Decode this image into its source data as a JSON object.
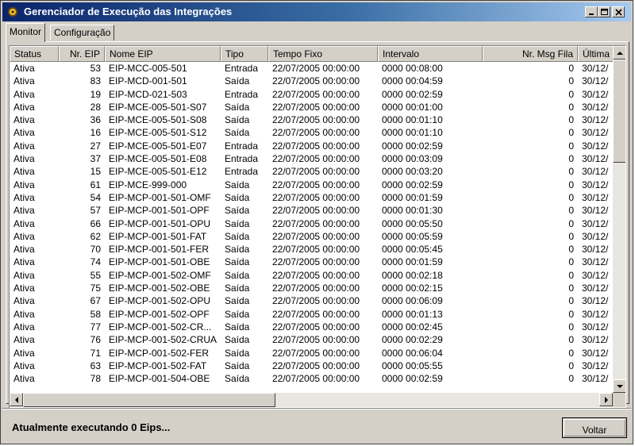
{
  "window": {
    "title": "Gerenciador de Execução das Integrações"
  },
  "tabs": [
    {
      "label": "Monitor"
    },
    {
      "label": "Configuração"
    }
  ],
  "columns": [
    "Status",
    "Nr. EIP",
    "Nome EIP",
    "Tipo",
    "Tempo Fixo",
    "Intervalo",
    "Nr. Msg Fila",
    "Última I"
  ],
  "rows": [
    [
      "Ativa",
      "53",
      "EIP-MCC-005-501",
      "Entrada",
      "22/07/2005 00:00:00",
      "0000 00:08:00",
      "0",
      "30/12/"
    ],
    [
      "Ativa",
      "83",
      "EIP-MCD-001-501",
      "Saída",
      "22/07/2005 00:00:00",
      "0000 00:04:59",
      "0",
      "30/12/"
    ],
    [
      "Ativa",
      "19",
      "EIP-MCD-021-503",
      "Entrada",
      "22/07/2005 00:00:00",
      "0000 00:02:59",
      "0",
      "30/12/"
    ],
    [
      "Ativa",
      "28",
      "EIP-MCE-005-501-S07",
      "Saída",
      "22/07/2005 00:00:00",
      "0000 00:01:00",
      "0",
      "30/12/"
    ],
    [
      "Ativa",
      "36",
      "EIP-MCE-005-501-S08",
      "Saída",
      "22/07/2005 00:00:00",
      "0000 00:01:10",
      "0",
      "30/12/"
    ],
    [
      "Ativa",
      "16",
      "EIP-MCE-005-501-S12",
      "Saída",
      "22/07/2005 00:00:00",
      "0000 00:01:10",
      "0",
      "30/12/"
    ],
    [
      "Ativa",
      "27",
      "EIP-MCE-005-501-E07",
      "Entrada",
      "22/07/2005 00:00:00",
      "0000 00:02:59",
      "0",
      "30/12/"
    ],
    [
      "Ativa",
      "37",
      "EIP-MCE-005-501-E08",
      "Entrada",
      "22/07/2005 00:00:00",
      "0000 00:03:09",
      "0",
      "30/12/"
    ],
    [
      "Ativa",
      "15",
      "EIP-MCE-005-501-E12",
      "Entrada",
      "22/07/2005 00:00:00",
      "0000 00:03:20",
      "0",
      "30/12/"
    ],
    [
      "Ativa",
      "61",
      "EIP-MCE-999-000",
      "Saída",
      "22/07/2005 00:00:00",
      "0000 00:02:59",
      "0",
      "30/12/"
    ],
    [
      "Ativa",
      "54",
      "EIP-MCP-001-501-OMF",
      "Saída",
      "22/07/2005 00:00:00",
      "0000 00:01:59",
      "0",
      "30/12/"
    ],
    [
      "Ativa",
      "57",
      "EIP-MCP-001-501-OPF",
      "Saída",
      "22/07/2005 00:00:00",
      "0000 00:01:30",
      "0",
      "30/12/"
    ],
    [
      "Ativa",
      "66",
      "EIP-MCP-001-501-OPU",
      "Saída",
      "22/07/2005 00:00:00",
      "0000 00:05:50",
      "0",
      "30/12/"
    ],
    [
      "Ativa",
      "62",
      "EIP-MCP-001-501-FAT",
      "Saída",
      "22/07/2005 00:00:00",
      "0000 00:05:59",
      "0",
      "30/12/"
    ],
    [
      "Ativa",
      "70",
      "EIP-MCP-001-501-FER",
      "Saída",
      "22/07/2005 00:00:00",
      "0000 00:05:45",
      "0",
      "30/12/"
    ],
    [
      "Ativa",
      "74",
      "EIP-MCP-001-501-OBE",
      "Saída",
      "22/07/2005 00:00:00",
      "0000 00:01:59",
      "0",
      "30/12/"
    ],
    [
      "Ativa",
      "55",
      "EIP-MCP-001-502-OMF",
      "Saída",
      "22/07/2005 00:00:00",
      "0000 00:02:18",
      "0",
      "30/12/"
    ],
    [
      "Ativa",
      "75",
      "EIP-MCP-001-502-OBE",
      "Saída",
      "22/07/2005 00:00:00",
      "0000 00:02:15",
      "0",
      "30/12/"
    ],
    [
      "Ativa",
      "67",
      "EIP-MCP-001-502-OPU",
      "Saída",
      "22/07/2005 00:00:00",
      "0000 00:06:09",
      "0",
      "30/12/"
    ],
    [
      "Ativa",
      "58",
      "EIP-MCP-001-502-OPF",
      "Saída",
      "22/07/2005 00:00:00",
      "0000 00:01:13",
      "0",
      "30/12/"
    ],
    [
      "Ativa",
      "77",
      "EIP-MCP-001-502-CR...",
      "Saída",
      "22/07/2005 00:00:00",
      "0000 00:02:45",
      "0",
      "30/12/"
    ],
    [
      "Ativa",
      "76",
      "EIP-MCP-001-502-CRUA",
      "Saída",
      "22/07/2005 00:00:00",
      "0000 00:02:29",
      "0",
      "30/12/"
    ],
    [
      "Ativa",
      "71",
      "EIP-MCP-001-502-FER",
      "Saída",
      "22/07/2005 00:00:00",
      "0000 00:06:04",
      "0",
      "30/12/"
    ],
    [
      "Ativa",
      "63",
      "EIP-MCP-001-502-FAT",
      "Saída",
      "22/07/2005 00:00:00",
      "0000 00:05:55",
      "0",
      "30/12/"
    ],
    [
      "Ativa",
      "78",
      "EIP-MCP-001-504-OBE",
      "Saída",
      "22/07/2005 00:00:00",
      "0000 00:02:59",
      "0",
      "30/12/"
    ]
  ],
  "status_text": "Atualmente executando 0 Eips...",
  "buttons": {
    "voltar": "Voltar"
  },
  "icons": {
    "app": "app-gear-icon",
    "minimize": "minimize-icon",
    "maximize": "maximize-icon",
    "close": "close-icon",
    "scroll_up": "arrow-up-icon",
    "scroll_down": "arrow-down-icon",
    "scroll_left": "arrow-left-icon",
    "scroll_right": "arrow-right-icon"
  },
  "colors": {
    "title_start": "#0a246a",
    "title_end": "#a6caf0",
    "face": "#d4d0c8"
  }
}
